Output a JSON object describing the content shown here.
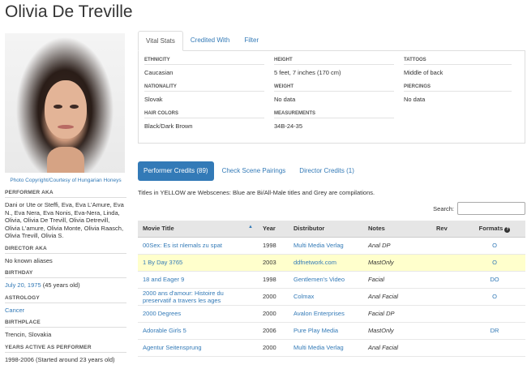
{
  "page_title": "Olivia De Treville",
  "photo_caption": "Photo Copyright/Courtesy of Hungarian Honeys",
  "left_sections": [
    {
      "label": "Performer AKA",
      "value": "Dani or Ute or Steffi, Eva, Eva L'Amure, Eva N., Eva Nera, Eva Nonis, Eva-Nera, Linda, Olivia, Olivia De Trevill, Olivia Detrevill, Olivia L'amure, Olivia Monte, Olivia Raasch, Olivia Trevill, Olivia S."
    },
    {
      "label": "Director AKA",
      "value": "No known aliases"
    },
    {
      "label": "Birthday",
      "link": "July 20, 1975",
      "value": " (45 years old)"
    },
    {
      "label": "Astrology",
      "link": "Cancer"
    },
    {
      "label": "Birthplace",
      "value": "Trencin, Slovakia"
    },
    {
      "label": "Years Active as Performer",
      "value": "1998-2006 (Started around 23 years old)"
    }
  ],
  "tabs": [
    {
      "label": "Vital Stats",
      "active": true
    },
    {
      "label": "Credited With",
      "active": false
    },
    {
      "label": "Filter",
      "active": false
    }
  ],
  "stats": [
    [
      {
        "label": "Ethnicity",
        "value": "Caucasian"
      },
      {
        "label": "Nationality",
        "value": "Slovak"
      },
      {
        "label": "Hair Colors",
        "value": "Black/Dark Brown"
      }
    ],
    [
      {
        "label": "Height",
        "value": "5 feet, 7 inches (170 cm)"
      },
      {
        "label": "Weight",
        "value": "No data"
      },
      {
        "label": "Measurements",
        "value": "34B-24-35"
      }
    ],
    [
      {
        "label": "Tattoos",
        "value": "Middle of back"
      },
      {
        "label": "Piercings",
        "value": "No data"
      }
    ]
  ],
  "pills": [
    {
      "label": "Performer Credits (89)",
      "active": true
    },
    {
      "label": "Check Scene Pairings",
      "active": false
    },
    {
      "label": "Director Credits (1)",
      "active": false
    }
  ],
  "note": "Titles in YELLOW are Webscenes: Blue are Bi/All-Male titles and Grey are compilations.",
  "search_label": "Search:",
  "columns": [
    "Movie Title",
    "Year",
    "Distributor",
    "Notes",
    "Rev",
    "Formats"
  ],
  "sort_icon": "sort-asc-icon",
  "help_icon": "question-circle-icon",
  "rows": [
    {
      "title": "00Sex: Es ist nlemals zu spat",
      "year": "1998",
      "distributor": "Multi Media Verlag",
      "notes": "Anal DP",
      "rev": "",
      "formats": "O",
      "yellow": false
    },
    {
      "title": "1 By Day 3765",
      "year": "2003",
      "distributor": "ddfnetwork.com",
      "notes": "MastOnly",
      "rev": "",
      "formats": "O",
      "yellow": true
    },
    {
      "title": "18 and Eager 9",
      "year": "1998",
      "distributor": "Gentlemen's Video",
      "notes": "Facial",
      "rev": "",
      "formats": "DO",
      "yellow": false
    },
    {
      "title": "2000 ans d'amour: Histoire du preservatif a travers les ages",
      "year": "2000",
      "distributor": "Colmax",
      "notes": "Anal Facial",
      "rev": "",
      "formats": "O",
      "yellow": false
    },
    {
      "title": "2000 Degrees",
      "year": "2000",
      "distributor": "Avalon Enterprises",
      "notes": "Facial DP",
      "rev": "",
      "formats": "",
      "yellow": false
    },
    {
      "title": "Adorable Girls 5",
      "year": "2006",
      "distributor": "Pure Play Media",
      "notes": "MastOnly",
      "rev": "",
      "formats": "DR",
      "yellow": false
    },
    {
      "title": "Agentur Seitensprung",
      "year": "2000",
      "distributor": "Multi Media Verlag",
      "notes": "Anal Facial",
      "rev": "",
      "formats": "",
      "yellow": false
    }
  ]
}
